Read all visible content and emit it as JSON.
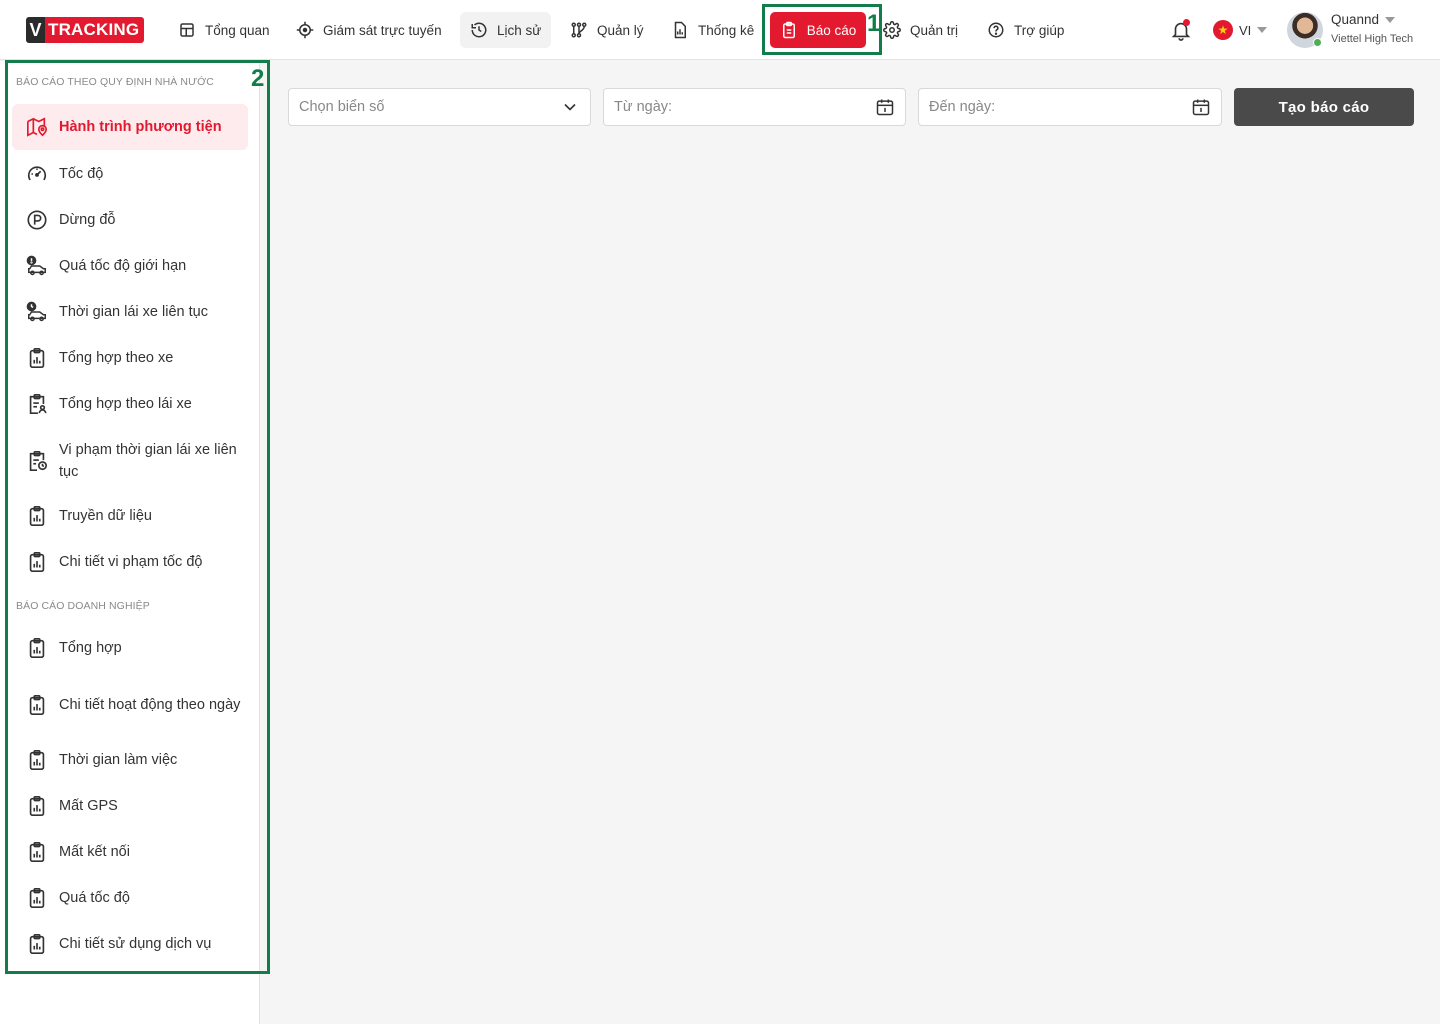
{
  "brand": {
    "v": "V",
    "name": "TRACKING"
  },
  "nav": [
    {
      "label": "Tổng quan",
      "icon": "dashboard-icon"
    },
    {
      "label": "Giám sát trực tuyến",
      "icon": "crosshair-icon"
    },
    {
      "label": "Lịch sử",
      "icon": "history-icon"
    },
    {
      "label": "Quản lý",
      "icon": "nodes-icon"
    },
    {
      "label": "Thống kê",
      "icon": "chart-doc-icon"
    },
    {
      "label": "Báo cáo",
      "icon": "clipboard-icon",
      "active": true
    },
    {
      "label": "Quản trị",
      "icon": "gear-icon"
    },
    {
      "label": "Trợ giúp",
      "icon": "help-icon"
    }
  ],
  "annotations": {
    "nav_marker": "1",
    "sidebar_marker": "2"
  },
  "lang": {
    "code": "VI",
    "flag_star": "★"
  },
  "user": {
    "name": "Quannd",
    "org": "Viettel High Tech"
  },
  "sidebar": {
    "section1_title": "Báo cáo theo quy định nhà nước",
    "section1_items": [
      {
        "label": "Hành trình phương tiện",
        "icon": "map-pin-icon",
        "active": true
      },
      {
        "label": "Tốc độ",
        "icon": "speedometer-icon"
      },
      {
        "label": "Dừng đỗ",
        "icon": "parking-icon"
      },
      {
        "label": "Quá tốc độ giới hạn",
        "icon": "car-alert-icon"
      },
      {
        "label": "Thời gian lái xe liên tục",
        "icon": "car-clock-icon"
      },
      {
        "label": "Tổng hợp theo xe",
        "icon": "clipboard-chart-icon"
      },
      {
        "label": "Tổng hợp theo lái xe",
        "icon": "clipboard-user-icon"
      },
      {
        "label": "Vi phạm thời gian lái xe liên tục",
        "icon": "clipboard-clock-icon"
      },
      {
        "label": "Truyền dữ liệu",
        "icon": "clipboard-chart-icon"
      },
      {
        "label": "Chi tiết vi phạm tốc độ",
        "icon": "clipboard-chart-icon"
      }
    ],
    "section2_title": "Báo cáo doanh nghiệp",
    "section2_items": [
      {
        "label": "Tổng hợp",
        "icon": "clipboard-chart-icon"
      },
      {
        "label": "Chi tiết hoạt động theo ngày",
        "icon": "clipboard-chart-icon"
      },
      {
        "label": "Thời gian làm việc",
        "icon": "clipboard-chart-icon"
      },
      {
        "label": "Mất GPS",
        "icon": "clipboard-chart-icon"
      },
      {
        "label": "Mất kết nối",
        "icon": "clipboard-chart-icon"
      },
      {
        "label": "Quá tốc độ",
        "icon": "clipboard-chart-icon"
      },
      {
        "label": "Chi tiết sử dụng dịch vụ",
        "icon": "clipboard-chart-icon"
      }
    ]
  },
  "filters": {
    "plate_placeholder": "Chọn biển số",
    "from_placeholder": "Từ ngày:",
    "to_placeholder": "Đến ngày:",
    "submit_label": "Tạo báo cáo"
  },
  "colors": {
    "accent": "#e3192f",
    "highlight": "#127c4a",
    "button": "#4a4a4a"
  }
}
